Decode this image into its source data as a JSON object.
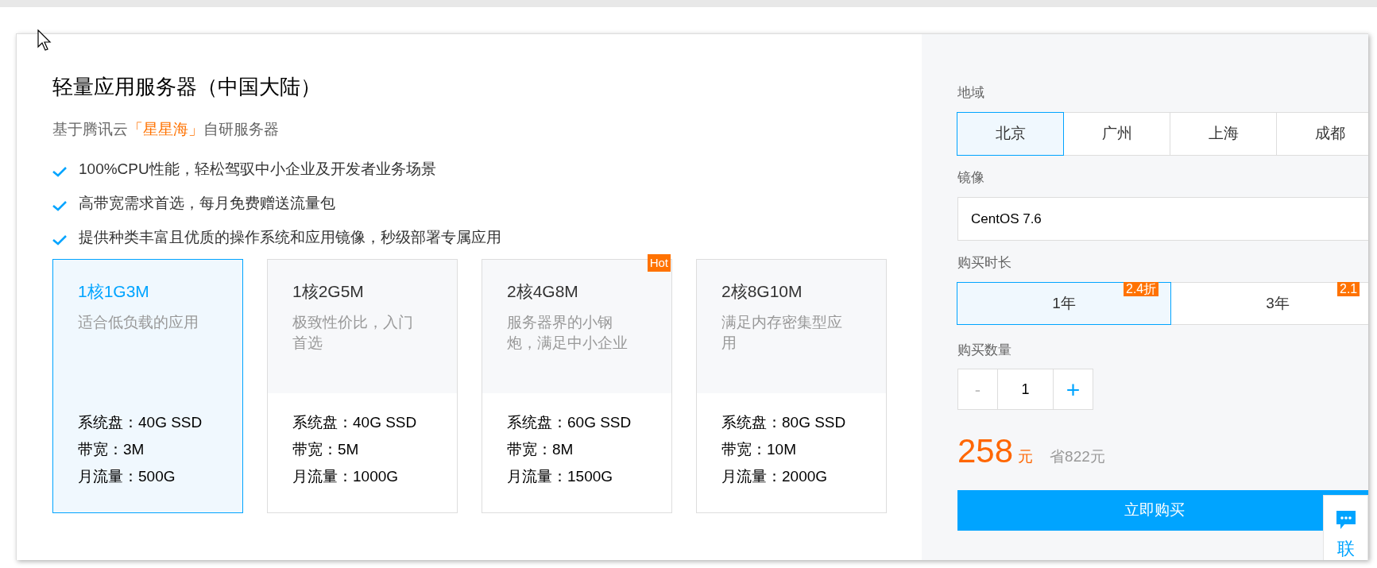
{
  "product": {
    "title": "轻量应用服务器（中国大陆）",
    "subtitle": {
      "prefix": "基于腾讯云",
      "highlight": "「星星海」",
      "suffix": "自研服务器"
    },
    "features": [
      "100%CPU性能，轻松驾驭中小企业及开发者业务场景",
      "高带宽需求首选，每月免费赠送流量包",
      "提供种类丰富且优质的操作系统和应用镜像，秒级部署专属应用"
    ]
  },
  "plans": [
    {
      "name": "1核1G3M",
      "description": "适合低负载的应用",
      "selected": true,
      "specs": [
        "系统盘：40G SSD",
        "带宽：3M",
        "月流量：500G"
      ]
    },
    {
      "name": "1核2G5M",
      "description": "极致性价比，入门首选",
      "selected": false,
      "specs": [
        "系统盘：40G SSD",
        "带宽：5M",
        "月流量：1000G"
      ]
    },
    {
      "name": "2核4G8M",
      "description": "服务器界的小钢炮，满足中小企业",
      "selected": false,
      "badge": "Hot",
      "specs": [
        "系统盘：60G SSD",
        "带宽：8M",
        "月流量：1500G"
      ]
    },
    {
      "name": "2核8G10M",
      "description": "满足内存密集型应用",
      "selected": false,
      "specs": [
        "系统盘：80G SSD",
        "带宽：10M",
        "月流量：2000G"
      ]
    }
  ],
  "config": {
    "region": {
      "label": "地域",
      "options": [
        {
          "label": "北京",
          "selected": true
        },
        {
          "label": "广州",
          "selected": false
        },
        {
          "label": "上海",
          "selected": false
        },
        {
          "label": "成都",
          "selected": false
        }
      ]
    },
    "image": {
      "label": "镜像",
      "value": "CentOS 7.6"
    },
    "duration": {
      "label": "购买时长",
      "options": [
        {
          "label": "1年",
          "discount": "2.4折",
          "selected": true
        },
        {
          "label": "3年",
          "discount": "2.1",
          "selected": false
        }
      ]
    },
    "quantity": {
      "label": "购买数量",
      "minus": "-",
      "value": "1",
      "plus": "+",
      "minus_disabled": true
    },
    "price": {
      "amount": "258",
      "unit": "元",
      "savings": "省822元"
    },
    "buy_button": "立即购买"
  },
  "chat_widget": {
    "label": "联"
  }
}
